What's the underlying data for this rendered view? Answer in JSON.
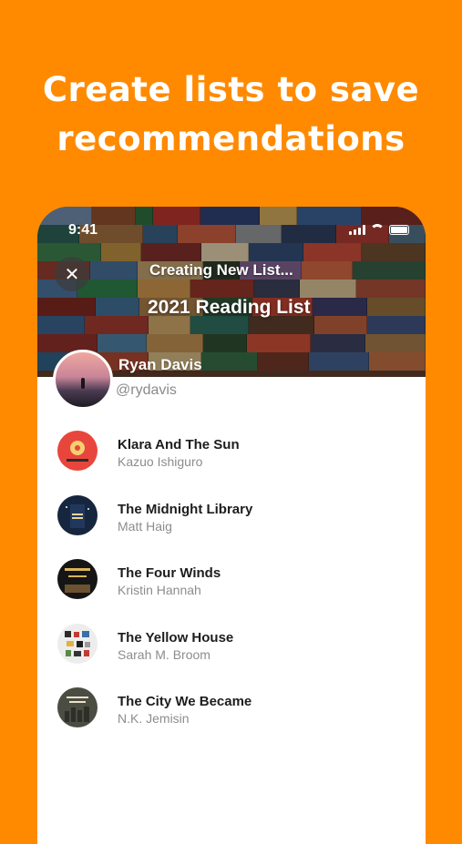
{
  "headline": {
    "line1": "Create lists to save",
    "line2": "recommendations"
  },
  "status_bar": {
    "time": "9:41"
  },
  "header": {
    "close_icon": "close-icon",
    "creating_label": "Creating New List...",
    "list_title": "2021 Reading List"
  },
  "profile": {
    "name": "Ryan Davis",
    "handle": "@rydavis"
  },
  "books": [
    {
      "title": "Klara And The Sun",
      "author": "Kazuo Ishiguro",
      "cover_color": "#E8463C"
    },
    {
      "title": "The Midnight Library",
      "author": "Matt Haig",
      "cover_color": "#16263F"
    },
    {
      "title": "The Four Winds",
      "author": "Kristin Hannah",
      "cover_color": "#151515"
    },
    {
      "title": "The Yellow House",
      "author": "Sarah M. Broom",
      "cover_color": "#EDEDED"
    },
    {
      "title": "The City We Became",
      "author": "N.K. Jemisin",
      "cover_color": "#4B4D43"
    }
  ],
  "colors": {
    "background": "#FF8A00",
    "card": "#FFFFFF",
    "title_text": "#1D1D1D",
    "secondary_text": "#8D8D8D"
  }
}
